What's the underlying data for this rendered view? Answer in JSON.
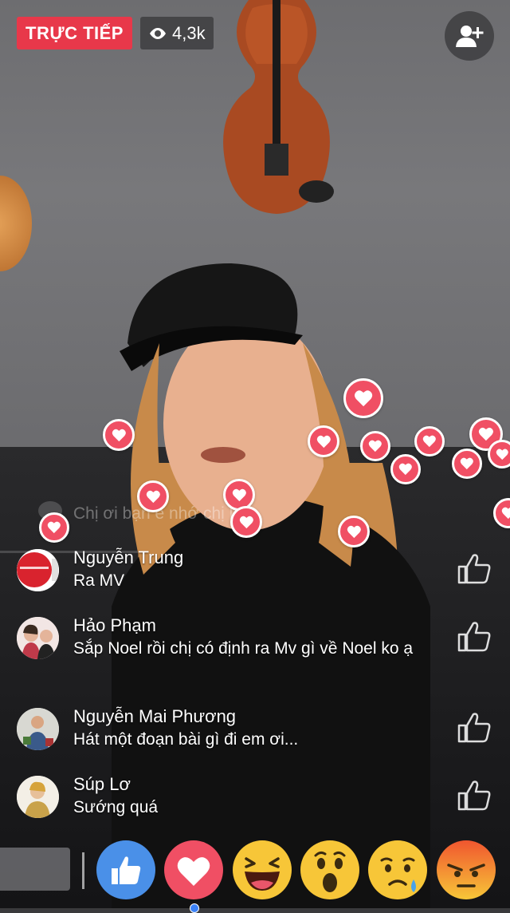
{
  "live": {
    "badge_label": "TRỰC TIẾP",
    "viewer_count": "4,3k"
  },
  "faded_comment": {
    "text": "Chị ơi bạn e nhớ chị lắm"
  },
  "comments": [
    {
      "name": "Nguyễn Trung",
      "text": "Ra MV"
    },
    {
      "name": "Hảo Phạm",
      "text": "Sắp Noel rồi chị có định ra Mv gì về Noel ko ạ"
    },
    {
      "name": "Nguyễn Mai Phương",
      "text": "Hát một đoạn bài gì đi em ơi..."
    },
    {
      "name": "Súp Lơ",
      "text": "Sướng quá"
    }
  ],
  "reactions": [
    "like-icon",
    "love-icon",
    "haha-icon",
    "wow-icon",
    "sad-icon",
    "angry-icon"
  ],
  "colors": {
    "live_red": "#e8384a",
    "heart_pink": "#f04f64",
    "like_blue": "#4a90e8",
    "emoji_yellow": "#f7c638",
    "angry_orange": "#f0562f"
  }
}
